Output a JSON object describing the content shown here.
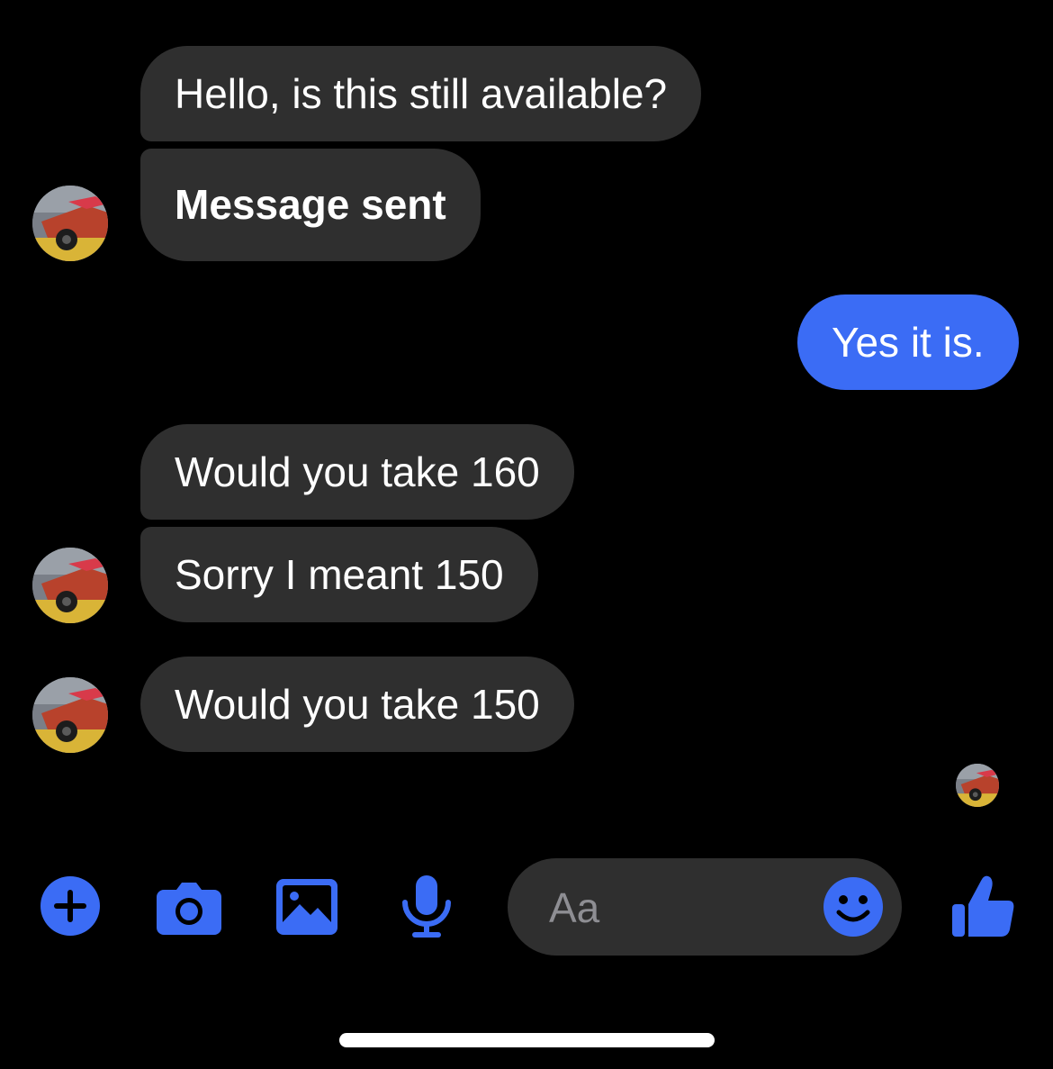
{
  "messages": [
    {
      "id": "m1",
      "text": "Hello, is this still available?",
      "direction": "incoming"
    },
    {
      "id": "m2",
      "text": "Message sent",
      "direction": "incoming",
      "emphasis": "bold"
    },
    {
      "id": "m3",
      "text": "Yes it is.",
      "direction": "outgoing"
    },
    {
      "id": "m4",
      "text": "Would you take 160",
      "direction": "incoming"
    },
    {
      "id": "m5",
      "text": "Sorry I meant 150",
      "direction": "incoming"
    },
    {
      "id": "m6",
      "text": "Would you take 150",
      "direction": "incoming"
    }
  ],
  "composer": {
    "placeholder": "Aa"
  },
  "toolbar": {
    "icons": [
      "plus-icon",
      "camera-icon",
      "image-icon",
      "microphone-icon",
      "emoji-icon",
      "thumbs-up-icon"
    ]
  },
  "colors": {
    "background": "#000000",
    "incoming_bubble": "#2f2f2f",
    "outgoing_bubble": "#3b6cf5",
    "accent": "#3b6cf5",
    "text": "#ffffff",
    "placeholder": "#8e8e93"
  }
}
